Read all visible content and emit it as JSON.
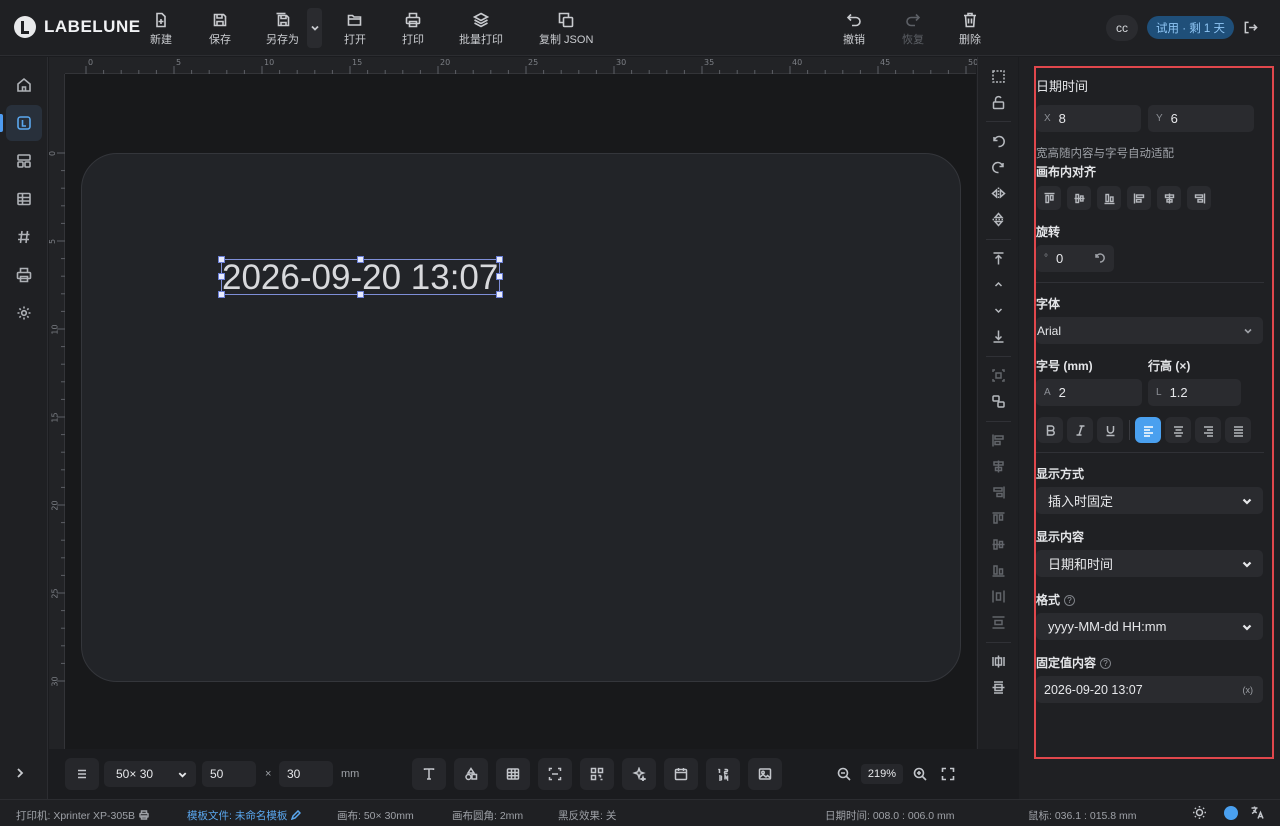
{
  "app": {
    "name": "LABELUNE"
  },
  "toolbar": {
    "new": "新建",
    "save": "保存",
    "save_as": "另存为",
    "open": "打开",
    "print": "打印",
    "batch_print": "批量打印",
    "copy_json": "复制 JSON",
    "undo": "撤销",
    "redo": "恢复",
    "delete": "删除"
  },
  "user": {
    "initials": "cc",
    "trial": "试用 · 剩 1 天"
  },
  "ruler": {
    "top": [
      "0",
      "5",
      "10",
      "15",
      "20",
      "25",
      "30",
      "35",
      "40",
      "45",
      "50"
    ],
    "left": [
      "0",
      "5",
      "10",
      "15",
      "20",
      "25",
      "30"
    ]
  },
  "canvas": {
    "element_text": "2026-09-20 13:07"
  },
  "panel": {
    "title": "日期时间",
    "x_prefix": "X",
    "x": "8",
    "y_prefix": "Y",
    "y": "6",
    "auto_fit_note": "宽高随内容与字号自动适配",
    "align_label": "画布内对齐",
    "rotate_label": "旋转",
    "rotate_prefix": "°",
    "rotate": "0",
    "font_label": "字体",
    "font_value": "Arial",
    "size_label": "字号 (mm)",
    "size_prefix": "A",
    "size": "2",
    "line_height_label": "行高 (×)",
    "line_height_prefix": "L",
    "line_height": "1.2",
    "display_mode_label": "显示方式",
    "display_mode": "插入时固定",
    "display_content_label": "显示内容",
    "display_content": "日期和时间",
    "format_label": "格式",
    "format": "yyyy-MM-dd HH:mm",
    "fixed_label": "固定值内容",
    "fixed_value": "2026-09-20 13:07",
    "fixed_tag": "(x)",
    "help": "?",
    "text_align": "left"
  },
  "bottom": {
    "size_preset": "50× 30",
    "width": "50",
    "times": "×",
    "height": "30",
    "unit": "mm",
    "zoom": "219%"
  },
  "status": {
    "printer": "打印机: Xprinter XP-305B",
    "template_label": "模板文件:",
    "template_name": "未命名模板",
    "canvas": "画布: 50× 30mm",
    "corner": "画布圆角: 2mm",
    "invert": "黑反效果: 关",
    "element": "日期时间: 008.0 : 006.0 mm",
    "mouse": "鼠标: 036.1 : 015.8 mm"
  },
  "colors": {
    "accent": "#4aa0ef",
    "highlight_box": "#e0474c",
    "selection": "#7e8ed8"
  }
}
